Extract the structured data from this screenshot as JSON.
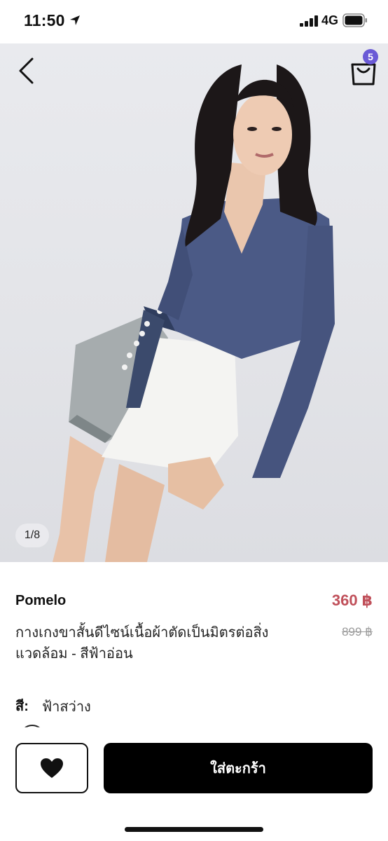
{
  "status_bar": {
    "time": "11:50",
    "network": "4G",
    "icons": [
      "location-arrow-icon",
      "signal-icon",
      "battery-icon"
    ]
  },
  "header": {
    "back_icon": "chevron-left-icon",
    "cart_icon": "shopping-bag-icon",
    "cart_count": "5"
  },
  "gallery": {
    "page_indicator": "1/8"
  },
  "product": {
    "brand": "Pomelo",
    "price": "360 ฿",
    "old_price": "899 ฿",
    "title": "กางเกงขาสั้นดีไซน์เนื้อผ้าตัดเป็นมิตรต่อสิ่งแวดล้อม - สีฟ้าอ่อน",
    "color_label": "สี:",
    "color_value": "ฟ้าสว่าง"
  },
  "actions": {
    "wishlist_icon": "heart-icon",
    "add_to_cart_label": "ใส่ตะกร้า"
  },
  "colors": {
    "price": "#c0505a",
    "badge": "#6a5ad6",
    "primary_button": "#000000"
  }
}
